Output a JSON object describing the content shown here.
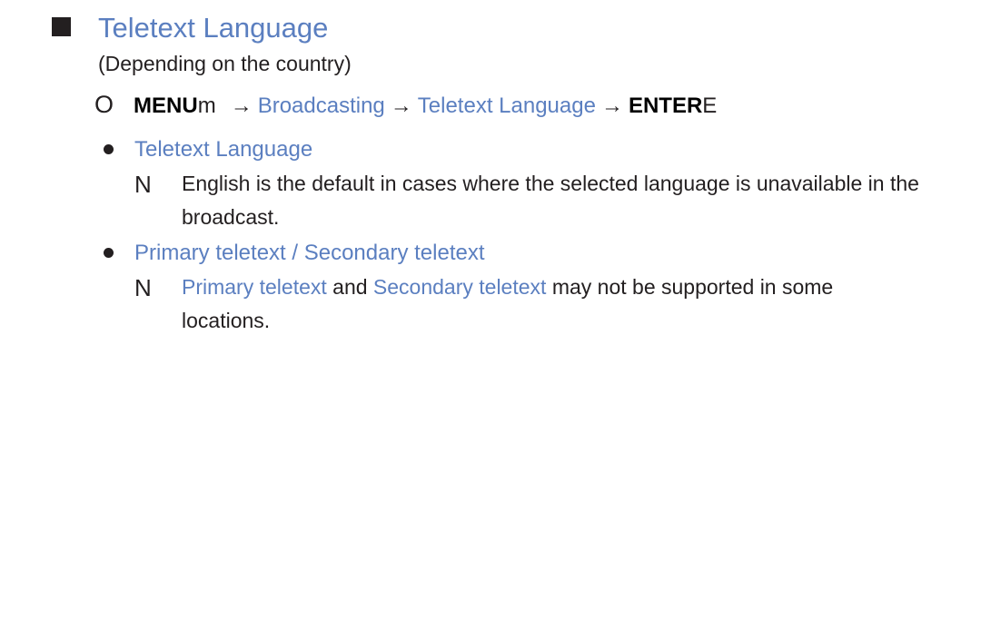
{
  "section": {
    "title": "Teletext Language",
    "subtitle": "(Depending on the country)"
  },
  "menu_path": {
    "icon": "O",
    "menu_label": "MENU",
    "menu_suffix": "m",
    "arrow": "→",
    "step1": "Broadcasting",
    "step2": "Teletext Language",
    "enter_label": "ENTER",
    "enter_suffix": "E"
  },
  "items": [
    {
      "heading": "Teletext Language",
      "note_icon": "N",
      "note_text": "English is the default in cases where the selected language is unavailable in the broadcast."
    },
    {
      "heading": "Primary teletext / Secondary teletext",
      "note_icon": "N",
      "note_part1": "Primary teletext",
      "note_and": " and ",
      "note_part2": "Secondary teletext",
      "note_rest": " may not be supported in some locations."
    }
  ],
  "colors": {
    "accent_blue": "#5b7fc0",
    "text": "#231f20"
  }
}
